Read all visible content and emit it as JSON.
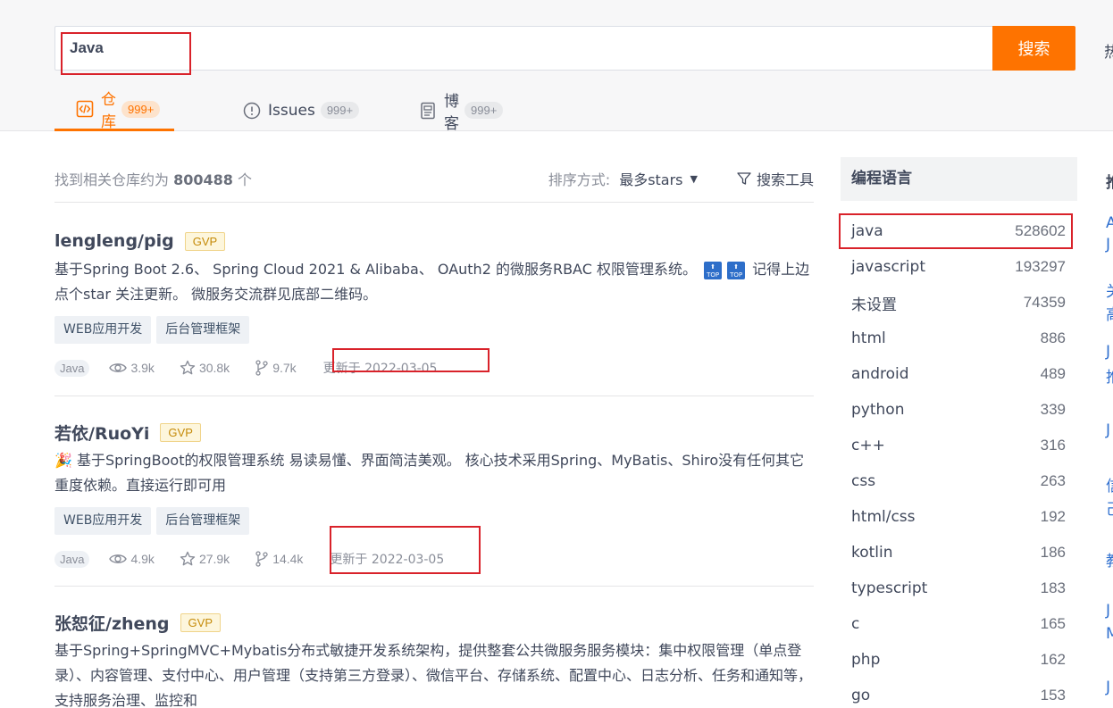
{
  "search": {
    "query": "Java",
    "button_label": "搜索",
    "hot_label_cut": "热"
  },
  "tabs": [
    {
      "label": "仓库",
      "count": "999+",
      "icon": "code-repo-icon",
      "active": true
    },
    {
      "label": "Issues",
      "count": "999+",
      "icon": "issue-circle-icon",
      "active": false
    },
    {
      "label": "博客",
      "count": "999+",
      "icon": "blog-doc-icon",
      "active": false
    }
  ],
  "results": {
    "found_prefix": "找到相关仓库约为",
    "found_count": "800488",
    "found_suffix": "个",
    "sort_label": "排序方式:",
    "sort_value": "最多stars",
    "tools_label": "搜索工具"
  },
  "repos": [
    {
      "name": "lengleng/pig",
      "badge": "GVP",
      "desc_part1": "基于Spring Boot 2.6、 Spring Cloud 2021 & Alibaba、 OAuth2 的微服务RBAC 权限管理系统。",
      "desc_badge": "TOP",
      "desc_part2": "记得上边点个star 关注更新。 微服务交流群见底部二维码。",
      "tags": [
        "WEB应用开发",
        "后台管理框架"
      ],
      "language": "Java",
      "watches": "3.9k",
      "stars": "30.8k",
      "forks": "9.7k",
      "updated": "更新于 2022-03-05"
    },
    {
      "name": "若依/RuoYi",
      "badge": "GVP",
      "desc_emoji": "🎉",
      "desc": "基于SpringBoot的权限管理系统 易读易懂、界面简洁美观。 核心技术采用Spring、MyBatis、Shiro没有任何其它重度依赖。直接运行即可用",
      "tags": [
        "WEB应用开发",
        "后台管理框架"
      ],
      "language": "Java",
      "watches": "4.9k",
      "stars": "27.9k",
      "forks": "14.4k",
      "updated": "更新于 2022-03-05"
    },
    {
      "name": "张恕征/zheng",
      "badge": "GVP",
      "desc": "基于Spring+SpringMVC+Mybatis分布式敏捷开发系统架构，提供整套公共微服务服务模块：集中权限管理（单点登录）、内容管理、支付中心、用户管理（支持第三方登录）、微信平台、存储系统、配置中心、日志分析、任务和通知等，支持服务治理、监控和"
    }
  ],
  "sidebar": {
    "title": "编程语言",
    "languages": [
      {
        "name": "java",
        "count": "528602"
      },
      {
        "name": "javascript",
        "count": "193297"
      },
      {
        "name": "未设置",
        "count": "74359"
      },
      {
        "name": "html",
        "count": "886"
      },
      {
        "name": "android",
        "count": "489"
      },
      {
        "name": "python",
        "count": "339"
      },
      {
        "name": "c++",
        "count": "316"
      },
      {
        "name": "css",
        "count": "263"
      },
      {
        "name": "html/css",
        "count": "192"
      },
      {
        "name": "kotlin",
        "count": "186"
      },
      {
        "name": "typescript",
        "count": "183"
      },
      {
        "name": "c",
        "count": "165"
      },
      {
        "name": "php",
        "count": "162"
      },
      {
        "name": "go",
        "count": "153"
      }
    ]
  },
  "right_column_cut": {
    "heading": "推",
    "items": [
      "A",
      "J",
      "关",
      "高",
      "J",
      "推",
      "J",
      "信",
      "己",
      "教",
      "J",
      "M",
      "J"
    ]
  },
  "colors": {
    "accent": "#fe7300",
    "annotation_red": "#d9222a",
    "gvp_gold": "#c58b0a"
  }
}
